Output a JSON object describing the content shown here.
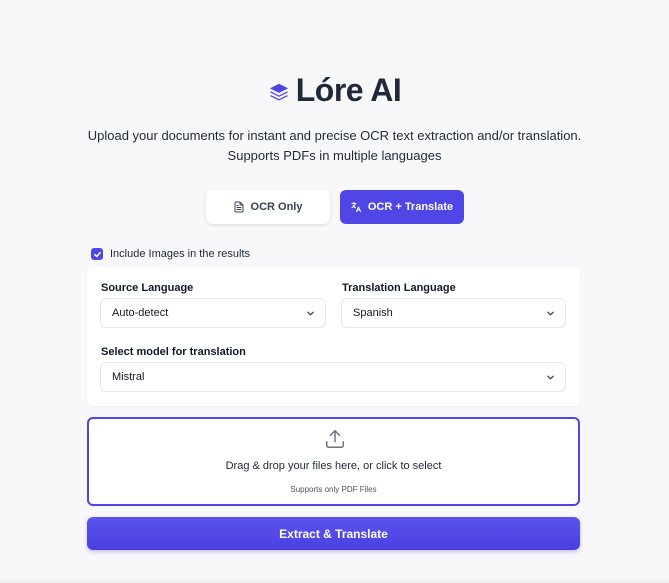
{
  "brand": {
    "name": "Lóre AI",
    "accent": "#4f46e5"
  },
  "subtitle": {
    "line1": "Upload your documents for instant and precise OCR text extraction and/or translation.",
    "line2": "Supports PDFs in multiple languages"
  },
  "modes": {
    "ocr_only": "OCR Only",
    "ocr_translate": "OCR + Translate",
    "selected": "OCR + Translate"
  },
  "options": {
    "include_images_label": "Include Images in the results",
    "include_images_checked": true
  },
  "settings": {
    "source_language_label": "Source Language",
    "source_language_value": "Auto-detect",
    "translation_language_label": "Translation Language",
    "translation_language_value": "Spanish",
    "model_label": "Select model for translation",
    "model_value": "Mistral"
  },
  "upload": {
    "icon": "upload-icon",
    "main_text": "Drag & drop your files here, or click to select",
    "sub_text": "Supports only PDF Files"
  },
  "submit_label": "Extract & Translate"
}
